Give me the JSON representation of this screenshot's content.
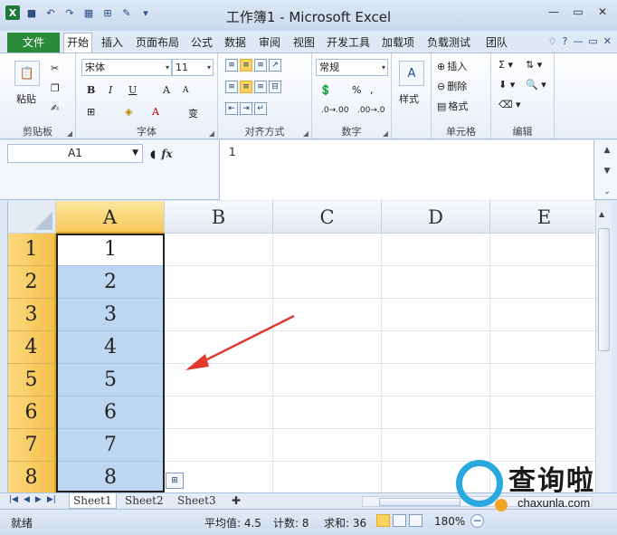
{
  "window": {
    "title": "工作簿1 - Microsoft Excel",
    "app_icon": "excel-logo",
    "qat_icons": [
      "save-icon",
      "undo-icon",
      "redo-icon",
      "customize-icon"
    ],
    "controls": [
      "minimize-icon",
      "maximize-icon",
      "close-icon"
    ]
  },
  "tabs": {
    "file": "文件",
    "items": [
      "开始",
      "插入",
      "页面布局",
      "公式",
      "数据",
      "审阅",
      "视图",
      "开发工具",
      "加载项",
      "负载测试",
      "团队"
    ],
    "active": "开始"
  },
  "ribbon": {
    "clipboard": {
      "paste": "粘贴",
      "label": "剪贴板"
    },
    "font": {
      "name": "宋体",
      "size": "11",
      "label": "字体",
      "bold": "B",
      "italic": "I",
      "underline": "U",
      "grow": "A",
      "shrink": "A",
      "font_color": "A",
      "wen": "变"
    },
    "alignment": {
      "label": "对齐方式"
    },
    "number": {
      "format": "常规",
      "percent": "%",
      "label": "数字"
    },
    "styles": {
      "label": "样式"
    },
    "cells": {
      "insert": "插入",
      "delete": "删除",
      "format": "格式",
      "label": "单元格"
    },
    "editing": {
      "label": "编辑"
    }
  },
  "formula_bar": {
    "name_box": "A1",
    "fx": "fx",
    "content": "1"
  },
  "grid": {
    "columns": [
      "A",
      "B",
      "C",
      "D",
      "E"
    ],
    "selected_column": "A",
    "rows": [
      "1",
      "2",
      "3",
      "4",
      "5",
      "6",
      "7",
      "8"
    ],
    "values_A": [
      "1",
      "2",
      "3",
      "4",
      "5",
      "6",
      "7",
      "8"
    ]
  },
  "sheets": {
    "tabs": [
      "Sheet1",
      "Sheet2",
      "Sheet3"
    ],
    "active": "Sheet1"
  },
  "status": {
    "ready": "就绪",
    "average": "平均值: 4.5",
    "count": "计数: 8",
    "sum": "求和: 36",
    "zoom": "180%",
    "zoom_minus": "−"
  },
  "watermark": {
    "title": "查询啦",
    "subtitle": "chaxunla.com"
  },
  "colors": {
    "selection_fill": "#bdd7f2",
    "header_highlight": "#f4c04a",
    "arrow": "#e03a2f",
    "file_tab": "#2a8c3a"
  }
}
